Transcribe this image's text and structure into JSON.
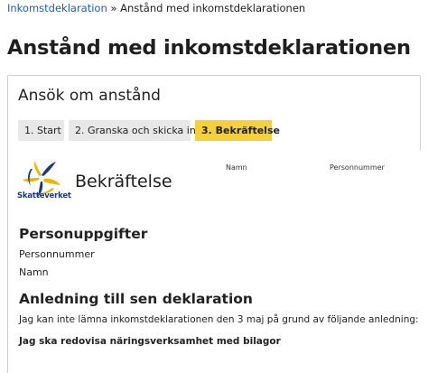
{
  "breadcrumb": {
    "link": "Inkomstdeklaration",
    "separator": " » ",
    "current": "Anstånd med inkomstdeklarationen"
  },
  "page_title": "Anstånd med inkomstdeklarationen",
  "card": {
    "title": "Ansök om anstånd",
    "steps": [
      {
        "label": "1. Start",
        "active": false
      },
      {
        "label": "2. Granska och skicka in",
        "active": false
      },
      {
        "label": "3. Bekräftelse",
        "active": true
      }
    ]
  },
  "confirmation": {
    "logo_text": "Skatteverket",
    "title": "Bekräftelse",
    "column_namn": "Namn",
    "column_personnummer": "Personnummer",
    "personal_heading": "Personuppgifter",
    "field_personnummer": "Personnummer",
    "field_namn": "Namn",
    "reason_heading": "Anledning till sen deklaration",
    "reason_intro": "Jag kan inte lämna inkomstdeklarationen den 3 maj på grund av följande anledning:",
    "reason_value": "Jag ska redovisa näringsverksamhet med bilagor"
  },
  "colors": {
    "link": "#1a5fb4",
    "active_step": "#f4d03f",
    "inactive_step": "#e8e8e8",
    "logo_blue": "#1a3b7a",
    "logo_yellow": "#f0b400"
  }
}
